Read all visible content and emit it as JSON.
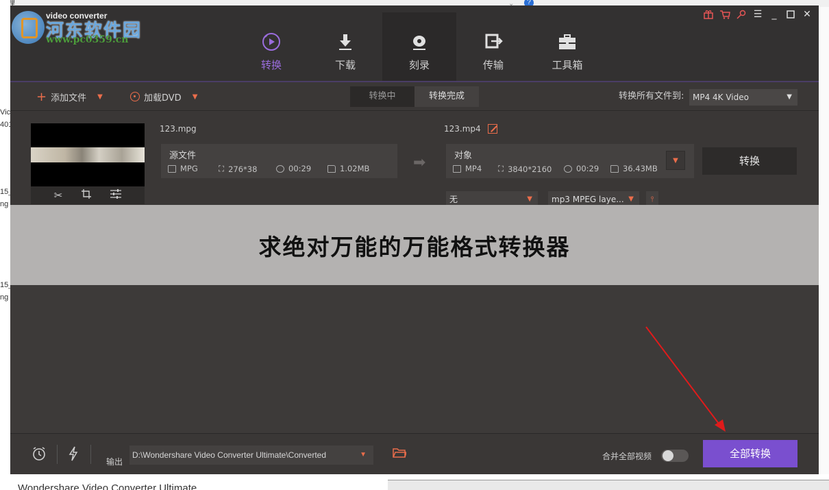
{
  "background": {
    "top_fragment": "管理",
    "left_fragments": [
      "Vic",
      "401",
      "15_",
      "ng",
      "15_",
      "ng"
    ],
    "bottom_text": "Wondershare Video Converter Ultimate",
    "help_icon": "?"
  },
  "app": {
    "brand": "video converter",
    "watermark_title": "河东软件园",
    "watermark_url": "www.pc0359.cn"
  },
  "nav": [
    {
      "label": "转换",
      "icon": "convert-icon"
    },
    {
      "label": "下载",
      "icon": "download-icon"
    },
    {
      "label": "刻录",
      "icon": "burn-icon"
    },
    {
      "label": "传输",
      "icon": "transfer-icon"
    },
    {
      "label": "工具箱",
      "icon": "toolbox-icon"
    }
  ],
  "toolbar": {
    "add_files": "添加文件",
    "load_dvd": "加载DVD",
    "tab_converting": "转换中",
    "tab_done": "转换完成",
    "convert_all_to_label": "转换所有文件到:",
    "format_value": "MP4 4K Video"
  },
  "item": {
    "source": {
      "filename": "123.mpg",
      "title": "源文件",
      "format": "MPG",
      "resolution": "276*38",
      "duration": "00:29",
      "size": "1.02MB"
    },
    "target": {
      "filename": "123.mp4",
      "title": "对象",
      "format": "MP4",
      "resolution": "3840*2160",
      "duration": "00:29",
      "size": "36.43MB"
    },
    "convert_button": "转换",
    "subtitle_select": "无",
    "audio_select": "mp3 MPEG laye..."
  },
  "banner": "求绝对万能的万能格式转换器",
  "bottom": {
    "output_label": "输出",
    "output_path": "D:\\Wondershare Video Converter Ultimate\\Converted",
    "merge_label": "合并全部视频",
    "convert_all": "全部转换"
  },
  "colors": {
    "accent_purple": "#7a4fcf",
    "accent_orange": "#ea6d4b",
    "annotation_red": "#e01b1b"
  }
}
